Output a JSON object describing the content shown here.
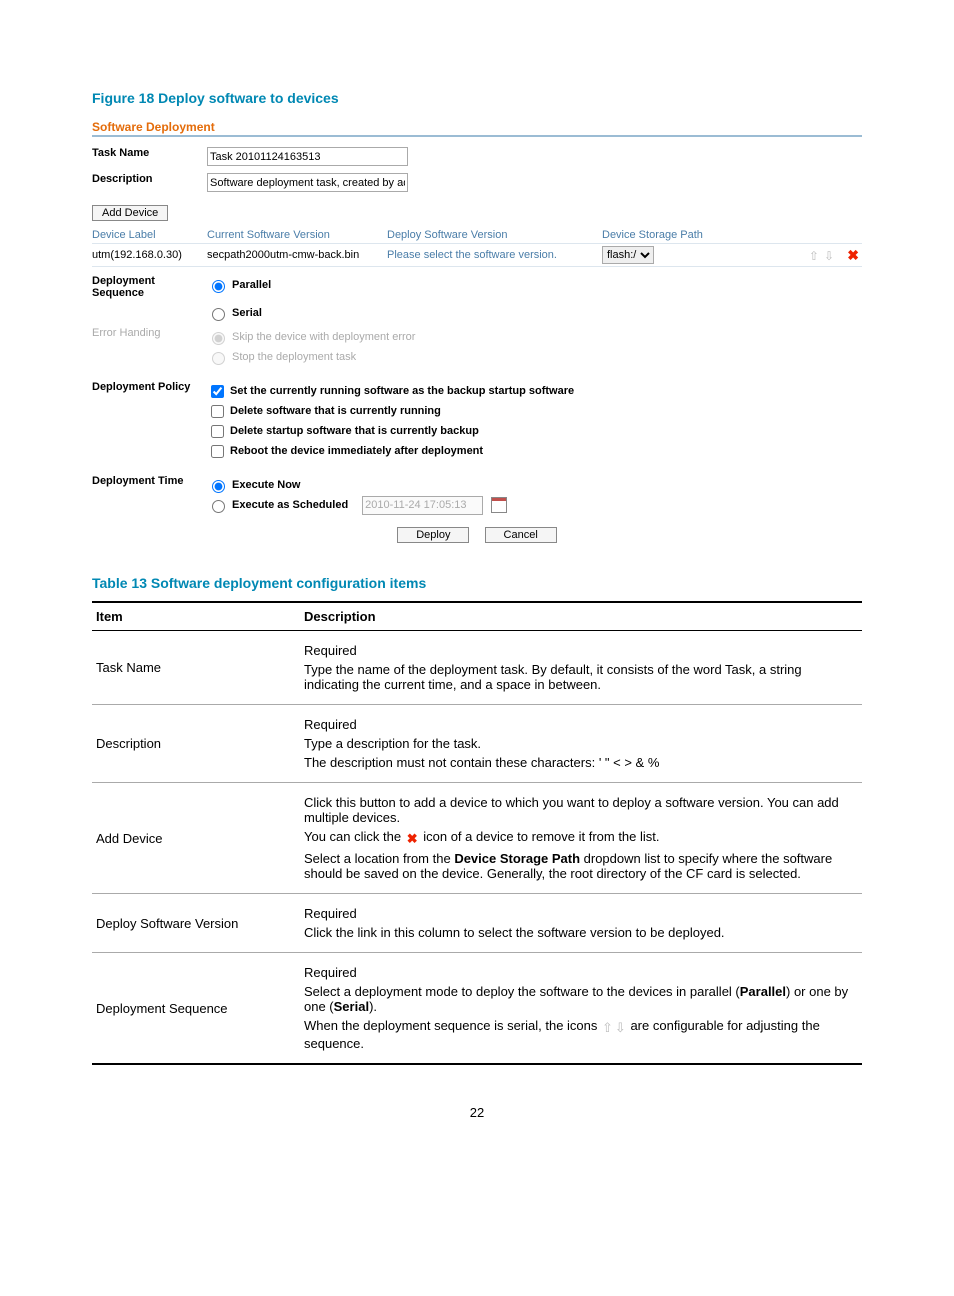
{
  "figure_title": "Figure 18 Deploy software to devices",
  "panel": {
    "title": "Software Deployment",
    "task_name_label": "Task Name",
    "task_name_value": "Task 20101124163513",
    "description_label": "Description",
    "description_value": "Software deployment task, created by admin.",
    "add_device_btn": "Add Device",
    "col": {
      "device_label": "Device Label",
      "current_sw": "Current Software Version",
      "deploy_sw": "Deploy Software Version",
      "storage": "Device Storage Path"
    },
    "row1": {
      "device": "utm(192.168.0.30)",
      "current": "secpath2000utm-cmw-back.bin",
      "deploy": "Please select the software version.",
      "storage": "flash:/"
    },
    "seq": {
      "label": "Deployment Sequence",
      "parallel": "Parallel",
      "serial": "Serial"
    },
    "err": {
      "label": "Error Handing",
      "skip": "Skip the device with deployment error",
      "stop": "Stop the deployment task"
    },
    "policy": {
      "label": "Deployment Policy",
      "p1": "Set the currently running software as the backup startup software",
      "p2": "Delete software that is currently running",
      "p3": "Delete startup software that is currently backup",
      "p4": "Reboot the device immediately after deployment"
    },
    "time": {
      "label": "Deployment Time",
      "now": "Execute Now",
      "sched": "Execute as Scheduled",
      "sched_value": "2010-11-24 17:05:13"
    },
    "deploy_btn": "Deploy",
    "cancel_btn": "Cancel"
  },
  "table_title": "Table 13 Software deployment configuration items",
  "th": {
    "item": "Item",
    "desc": "Description"
  },
  "t": {
    "r1_item": "Task Name",
    "r1_1": "Required",
    "r1_2": "Type the name of the deployment task. By default, it consists of the word Task, a string indicating the current time, and a space in between.",
    "r2_item": "Description",
    "r2_1": "Required",
    "r2_2": "Type a description for the task.",
    "r2_3": "The description must not contain these characters: ' \" < > & %",
    "r3_item": "Add Device",
    "r3_1": "Click this button to add a device to which you want to deploy a software version. You can add multiple devices.",
    "r3_2a": "You can click the ",
    "r3_2b": " icon of a device to remove it from the list.",
    "r3_3a": "Select a location from the ",
    "r3_3b": "Device Storage Path",
    "r3_3c": " dropdown list to specify where the software should be saved on the device. Generally, the root directory of the CF card is selected.",
    "r4_item": "Deploy Software Version",
    "r4_1": "Required",
    "r4_2": "Click the link in this column to select the software version to be deployed.",
    "r5_item": "Deployment Sequence",
    "r5_1": "Required",
    "r5_2a": "Select a deployment mode to deploy the software to the devices in parallel (",
    "r5_2b": "Parallel",
    "r5_2c": ") or one by one (",
    "r5_2d": "Serial",
    "r5_2e": ").",
    "r5_3a": "When the deployment sequence is serial, the icons ",
    "r5_3b": " are configurable for adjusting the sequence."
  },
  "page_number": "22"
}
